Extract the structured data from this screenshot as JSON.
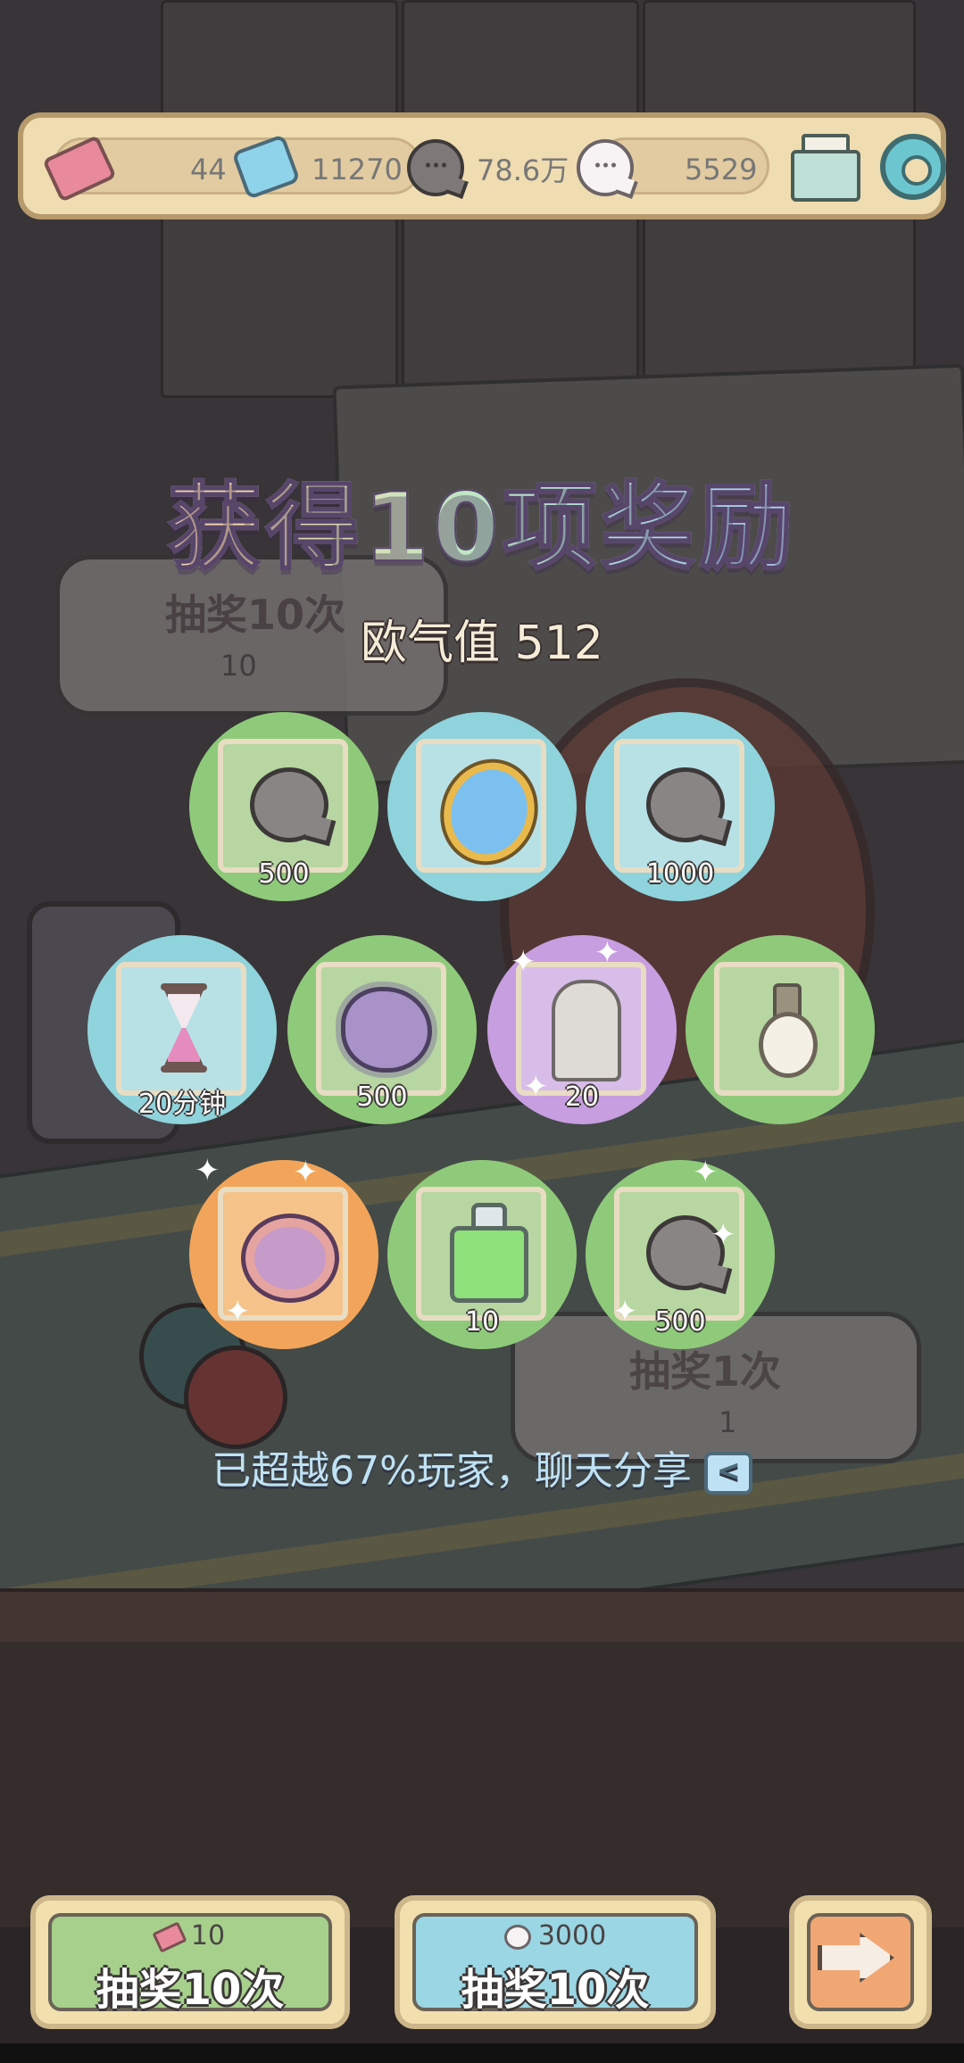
{
  "resources": {
    "tickets": "44",
    "gems": "11270",
    "dark_bubbles": "78.6万",
    "white_bubbles": "5529"
  },
  "icons": {
    "ticket": "ticket-icon",
    "gem": "gem-icon",
    "dark_bubble": "dark-bubble-icon",
    "white_bubble": "white-bubble-icon",
    "mail": "mail-icon",
    "settings": "gear-icon"
  },
  "background_cards": {
    "left": {
      "title": "抽奖10次",
      "cost": "10"
    },
    "right": {
      "title": "抽奖1次",
      "cost": "1"
    }
  },
  "result": {
    "title": "获得10项奖励",
    "luck_label": "欧气值 512"
  },
  "rewards": [
    {
      "item": "dark-bubble",
      "qty": "500",
      "bg": "green"
    },
    {
      "item": "blue-mirror",
      "qty": "",
      "bg": "blue"
    },
    {
      "item": "dark-bubble",
      "qty": "1000",
      "bg": "blue"
    },
    {
      "item": "hourglass",
      "qty": "20分钟",
      "bg": "blue"
    },
    {
      "item": "germ",
      "qty": "500",
      "bg": "green"
    },
    {
      "item": "statue",
      "qty": "20",
      "bg": "purple"
    },
    {
      "item": "pearl-pendant",
      "qty": "",
      "bg": "green"
    },
    {
      "item": "crab-ornament",
      "qty": "",
      "bg": "orange"
    },
    {
      "item": "green-potion",
      "qty": "10",
      "bg": "green"
    },
    {
      "item": "dark-bubble",
      "qty": "500",
      "bg": "green"
    }
  ],
  "share": {
    "text": "已超越67%玩家，聊天分享"
  },
  "buttons": {
    "draw_ticket": {
      "cost": "10",
      "label": "抽奖10次"
    },
    "draw_bubble": {
      "cost": "3000",
      "label": "抽奖10次"
    },
    "next": {
      "icon": "arrow-right-icon"
    }
  },
  "colors": {
    "green": "#8fca7a",
    "blue": "#8fd3dc",
    "purple": "#c79ee0",
    "orange": "#f2a55a"
  }
}
